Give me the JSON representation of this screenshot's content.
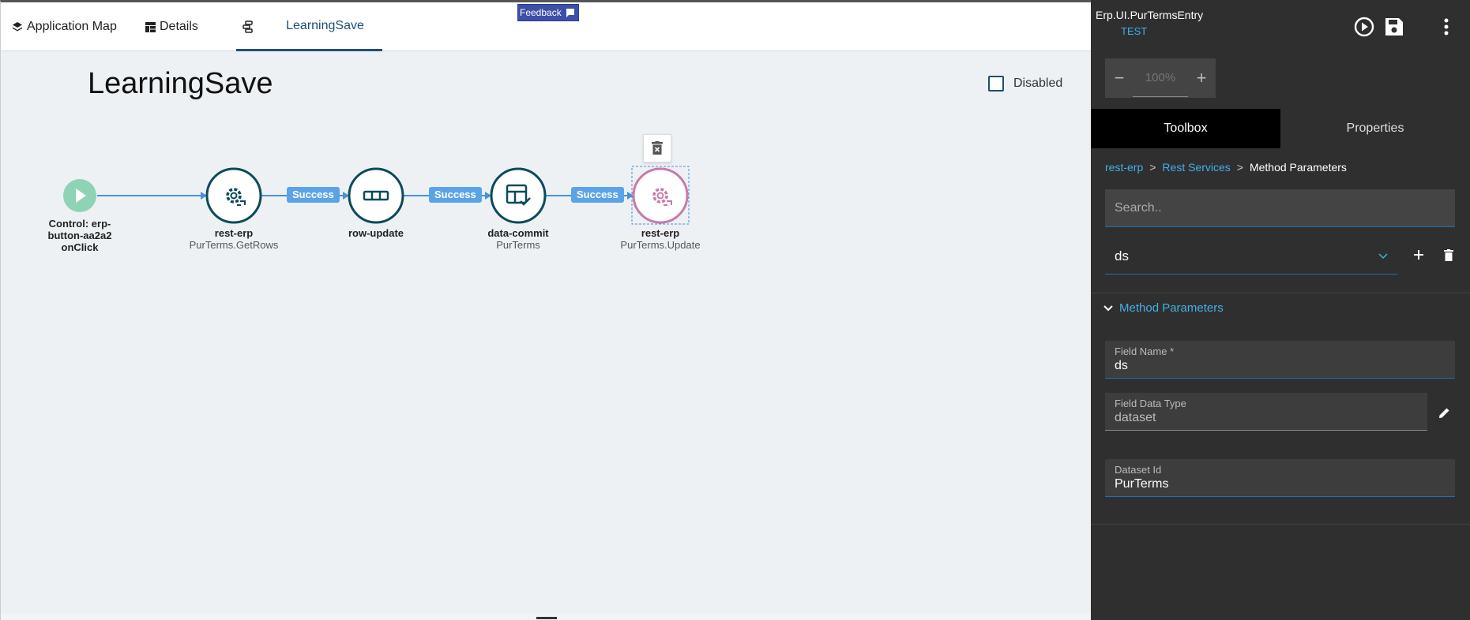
{
  "tabs": {
    "app_map": "Application Map",
    "details": "Details",
    "active": "LearningSave"
  },
  "feedback_label": "Feedback",
  "flow": {
    "title": "LearningSave",
    "disabled_label": "Disabled",
    "disabled_checked": false,
    "start_node": {
      "line1": "Control: erp-",
      "line2": "button-aa2a2",
      "line3": "onClick"
    },
    "nodes": [
      {
        "name": "rest-erp",
        "sub": "PurTerms.GetRows",
        "icon": "gear-arrows-icon"
      },
      {
        "name": "row-update",
        "sub": "",
        "icon": "row-icon"
      },
      {
        "name": "data-commit",
        "sub": "PurTerms",
        "icon": "table-check-icon"
      },
      {
        "name": "rest-erp",
        "sub": "PurTerms.Update",
        "icon": "gear-arrows-icon",
        "selected": true
      }
    ],
    "connectors": [
      "Success",
      "Success",
      "Success"
    ],
    "colors": {
      "primary": "#0d4a5c",
      "start": "#8fd3b6",
      "selected": "#c97aa8",
      "connector": "#4a90d9",
      "badge": "#5ba3e8"
    }
  },
  "panel": {
    "title": "Erp.UI.PurTermsEntry",
    "env": "TEST",
    "zoom": "100%",
    "tabs": {
      "toolbox": "Toolbox",
      "properties": "Properties"
    },
    "breadcrumb": {
      "level1": "rest-erp",
      "level2": "Rest Services",
      "current": "Method Parameters",
      "sep": ">"
    },
    "search_placeholder": "Search..",
    "selected_param": "ds",
    "section": "Method Parameters",
    "fields": {
      "name_label": "Field Name *",
      "name_value": "ds",
      "type_label": "Field Data Type",
      "type_value": "dataset",
      "dataset_label": "Dataset Id",
      "dataset_value": "PurTerms"
    }
  }
}
